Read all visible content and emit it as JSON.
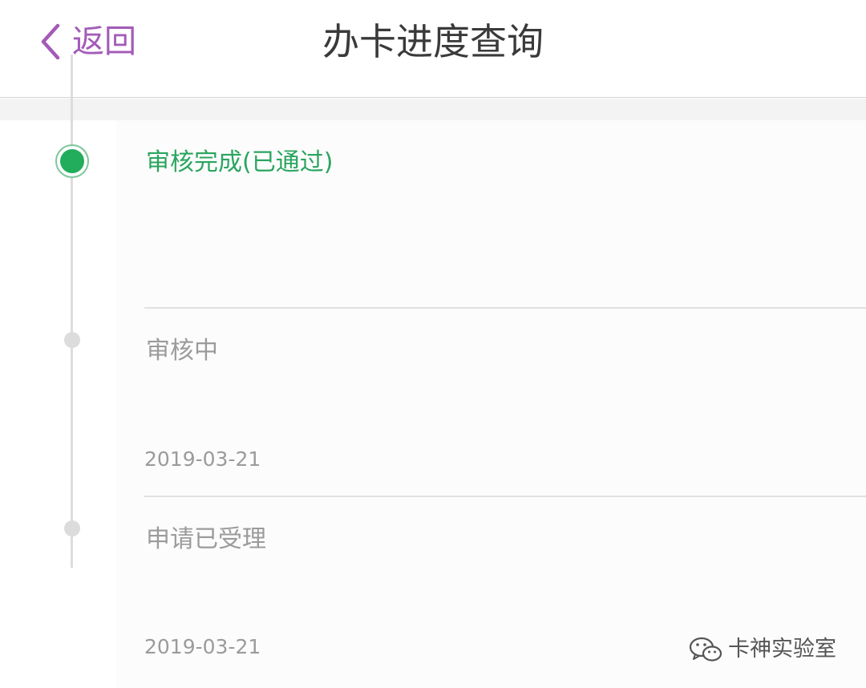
{
  "header": {
    "back_label": "返回",
    "title": "办卡进度查询"
  },
  "steps": [
    {
      "title": "审核完成(已通过)",
      "date": "",
      "status": "active"
    },
    {
      "title": "审核中",
      "date": "2019-03-21",
      "status": "inactive"
    },
    {
      "title": "申请已受理",
      "date": "2019-03-21",
      "status": "inactive"
    }
  ],
  "watermark": {
    "text": "卡神实验室",
    "icon": "wechat-icon"
  },
  "colors": {
    "accent": "#a35bb8",
    "success": "#22ad5c",
    "muted": "#9b9b9b",
    "timeline": "#dcdcdc"
  }
}
